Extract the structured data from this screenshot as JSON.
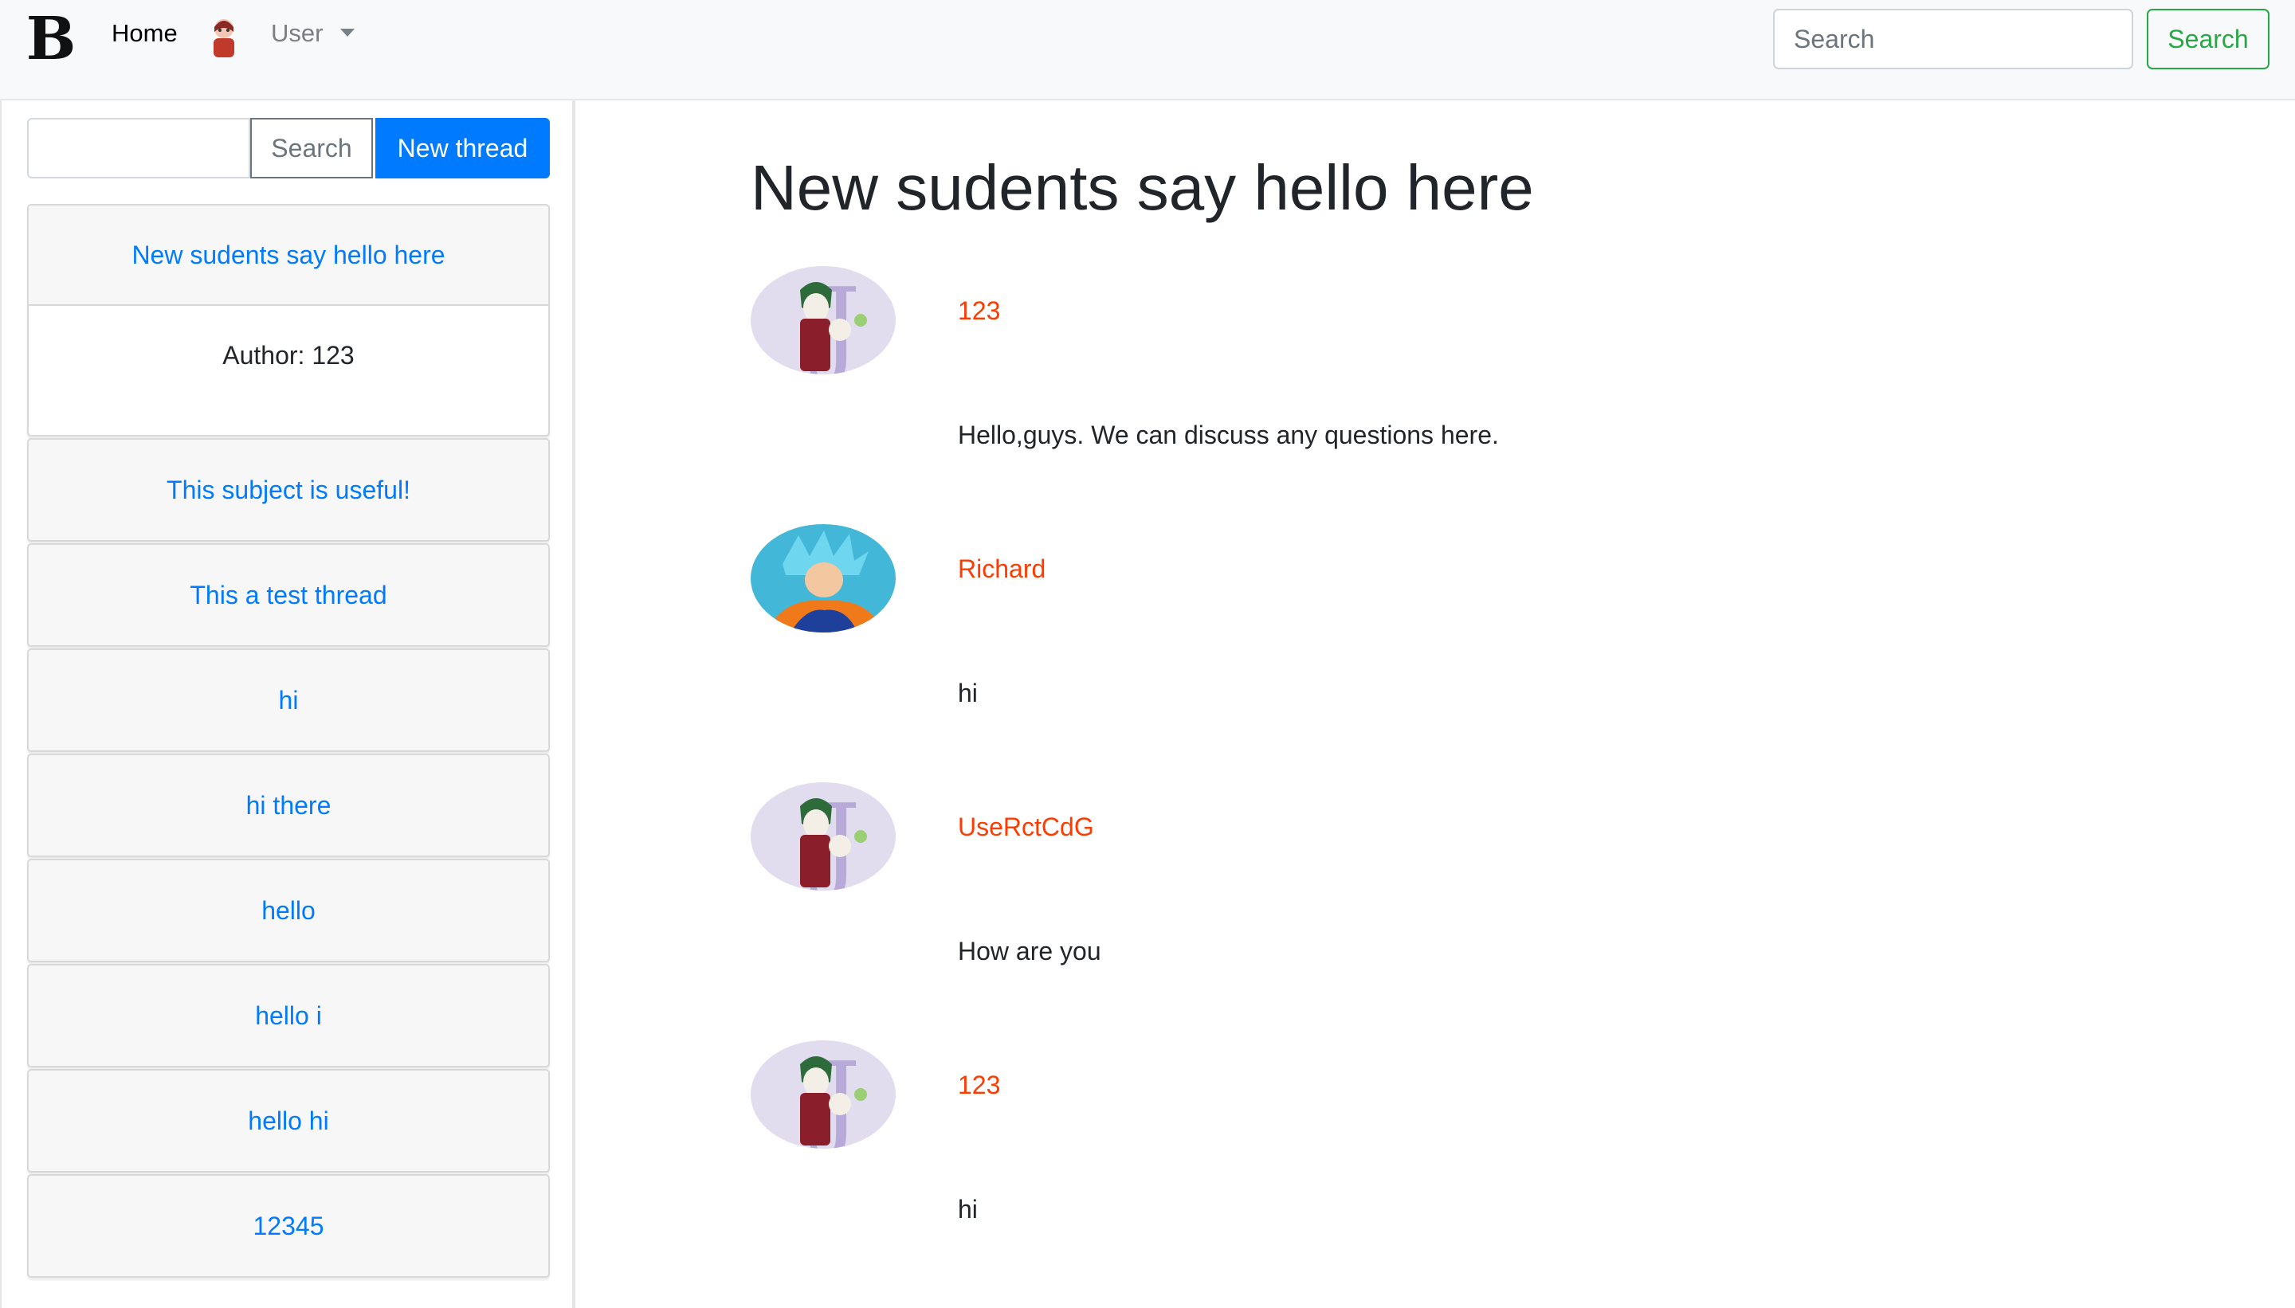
{
  "navbar": {
    "brand": "B",
    "home_label": "Home",
    "user_label": "User",
    "search_placeholder": "Search",
    "search_button": "Search",
    "colors": {
      "background": "#f8f9fa",
      "search_button": "#28a745"
    }
  },
  "sidebar": {
    "search_input_value": "",
    "search_button": "Search",
    "new_thread_button": "New thread",
    "threads": [
      {
        "title": "New sudents say hello here",
        "author_line": "Author: 123",
        "expanded": true
      },
      {
        "title": "This subject is useful!"
      },
      {
        "title": "This a test thread"
      },
      {
        "title": "hi"
      },
      {
        "title": "hi there"
      },
      {
        "title": "hello"
      },
      {
        "title": "hello i"
      },
      {
        "title": "hello hi"
      },
      {
        "title": "12345"
      }
    ],
    "colors": {
      "link": "#007bff",
      "primary_button": "#007bff"
    }
  },
  "main": {
    "title": "New sudents say hello here",
    "posts": [
      {
        "author": "123",
        "content": "Hello,guys. We can discuss any questions here.",
        "avatar": "joker-avatar-icon"
      },
      {
        "author": "Richard",
        "content": "hi",
        "avatar": "goku-avatar-icon"
      },
      {
        "author": "UseRctCdG",
        "content": "How are you",
        "avatar": "joker-avatar-icon"
      },
      {
        "author": "123",
        "content": "hi",
        "avatar": "joker-avatar-icon"
      }
    ],
    "colors": {
      "author": "#ff3b00"
    }
  }
}
